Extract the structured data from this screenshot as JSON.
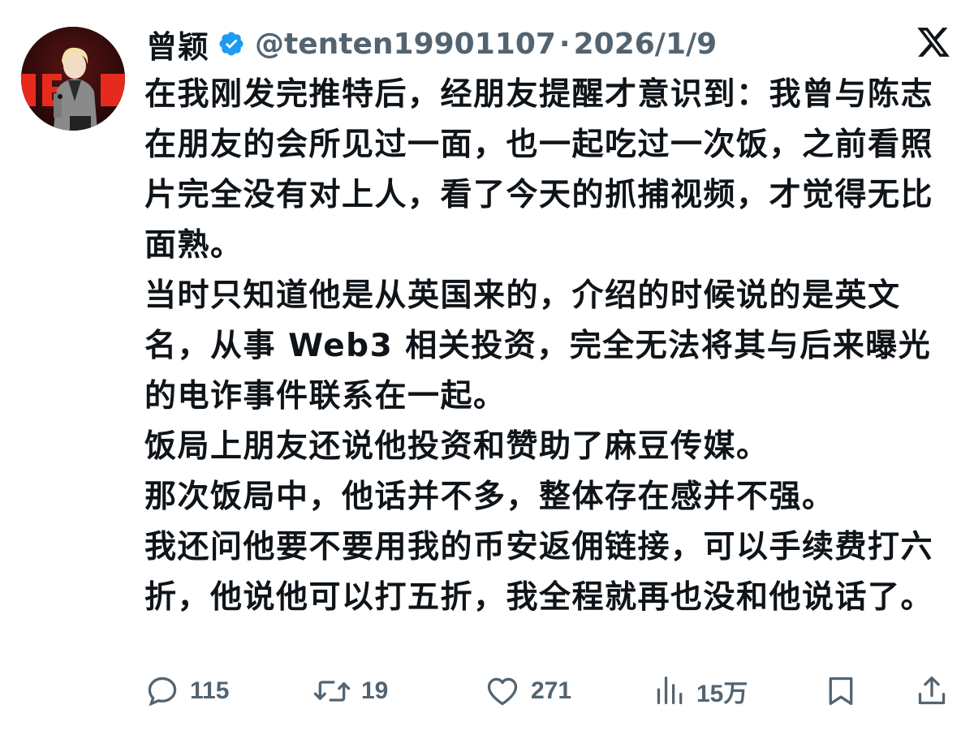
{
  "tweet": {
    "display_name": "曾颖",
    "handle": "@tenten19901107",
    "separator": "·",
    "date": "2026/1/9",
    "verified_icon": "verified-badge-icon",
    "paragraphs": [
      "在我刚发完推特后，经朋友提醒才意识到：我曾与陈志在朋友的会所见过一面，也一起吃过一次饭，之前看照片完全没有对上人，看了今天的抓捕视频，才觉得无比面熟。",
      "当时只知道他是从英国来的，介绍的时候说的是英文名，从事 Web3 相关投资，完全无法将其与后来曝光的电诈事件联系在一起。",
      "饭局上朋友还说他投资和赞助了麻豆传媒。",
      "那次饭局中，他话并不多，整体存在感并不强。",
      "我还问他要不要用我的币安返佣链接，可以手续费打六折，他说他可以打五折，我全程就再也没和他说话了。"
    ]
  },
  "actions": {
    "reply_count": "115",
    "retweet_count": "19",
    "like_count": "271",
    "views_count": "15万"
  },
  "colors": {
    "text": "#0f1419",
    "secondary": "#536471",
    "verified": "#1d9bf0",
    "background": "#ffffff"
  }
}
